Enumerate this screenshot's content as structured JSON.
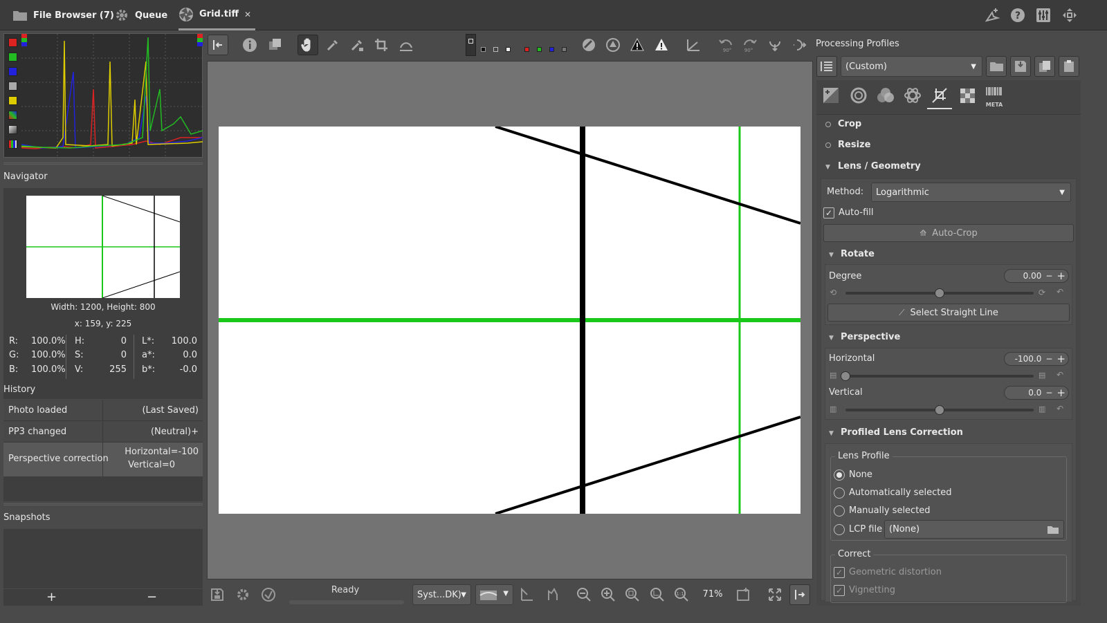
{
  "tabs": [
    {
      "label": "File Browser (7)",
      "icon": "folder-icon"
    },
    {
      "label": "Queue",
      "icon": "gear-icon"
    },
    {
      "label": "Grid.tiff",
      "icon": "aperture-icon",
      "close": "✕"
    }
  ],
  "navigator": {
    "title": "Navigator",
    "size_text": "Width: 1200, Height: 800",
    "coords_text": "x: 159, y: 225",
    "readout": {
      "r_label": "R:",
      "r_val": "100.0%",
      "g_label": "G:",
      "g_val": "100.0%",
      "b_label": "B:",
      "b_val": "100.0%",
      "h_label": "H:",
      "h_val": "0",
      "s_label": "S:",
      "s_val": "0",
      "v_label": "V:",
      "v_val": "255",
      "l_label": "L*:",
      "l_val": "100.0",
      "a_label": "a*:",
      "a_val": "0.0",
      "bb_label": "b*:",
      "bb_val": "-0.0"
    }
  },
  "history": {
    "title": "History",
    "rows": [
      {
        "action": "Photo loaded",
        "value": "(Last Saved)"
      },
      {
        "action": "PP3 changed",
        "value": "(Neutral)+"
      },
      {
        "action": "Perspective correction",
        "value_line1": "Horizontal=-100",
        "value_line2": "Vertical=0"
      }
    ]
  },
  "snapshots": {
    "title": "Snapshots",
    "add": "+",
    "remove": "−"
  },
  "status": {
    "text": "Ready",
    "profile": "Syst...DK)",
    "zoom": "71%"
  },
  "profiles": {
    "title": "Processing Profiles",
    "selected": "(Custom)"
  },
  "tools": {
    "crop": "Crop",
    "resize": "Resize",
    "lens_geometry": "Lens / Geometry",
    "method_label": "Method:",
    "method_value": "Logarithmic",
    "autofill": "Auto-fill",
    "autocrop": "Auto-Crop",
    "rotate": "Rotate",
    "degree_label": "Degree",
    "degree_value": "0.00",
    "degree_level": 0.5,
    "select_straight": "Select Straight Line",
    "perspective": "Perspective",
    "horizontal_label": "Horizontal",
    "horizontal_value": "-100.0",
    "horizontal_level": 0.0,
    "vertical_label": "Vertical",
    "vertical_value": "0.0",
    "vertical_level": 0.5,
    "profiled_lens": "Profiled Lens Correction",
    "lens_profile": "Lens Profile",
    "opt_none": "None",
    "opt_auto": "Automatically selected",
    "opt_manual": "Manually selected",
    "opt_lcp": "LCP file",
    "lcp_value": "(None)",
    "correct": "Correct",
    "geo_dist": "Geometric distortion",
    "vignetting": "Vignetting",
    "meta_tab": "META"
  },
  "colors": {
    "accent_green": "#19c819",
    "background": "#4a4a4a",
    "canvas": "#737373"
  }
}
